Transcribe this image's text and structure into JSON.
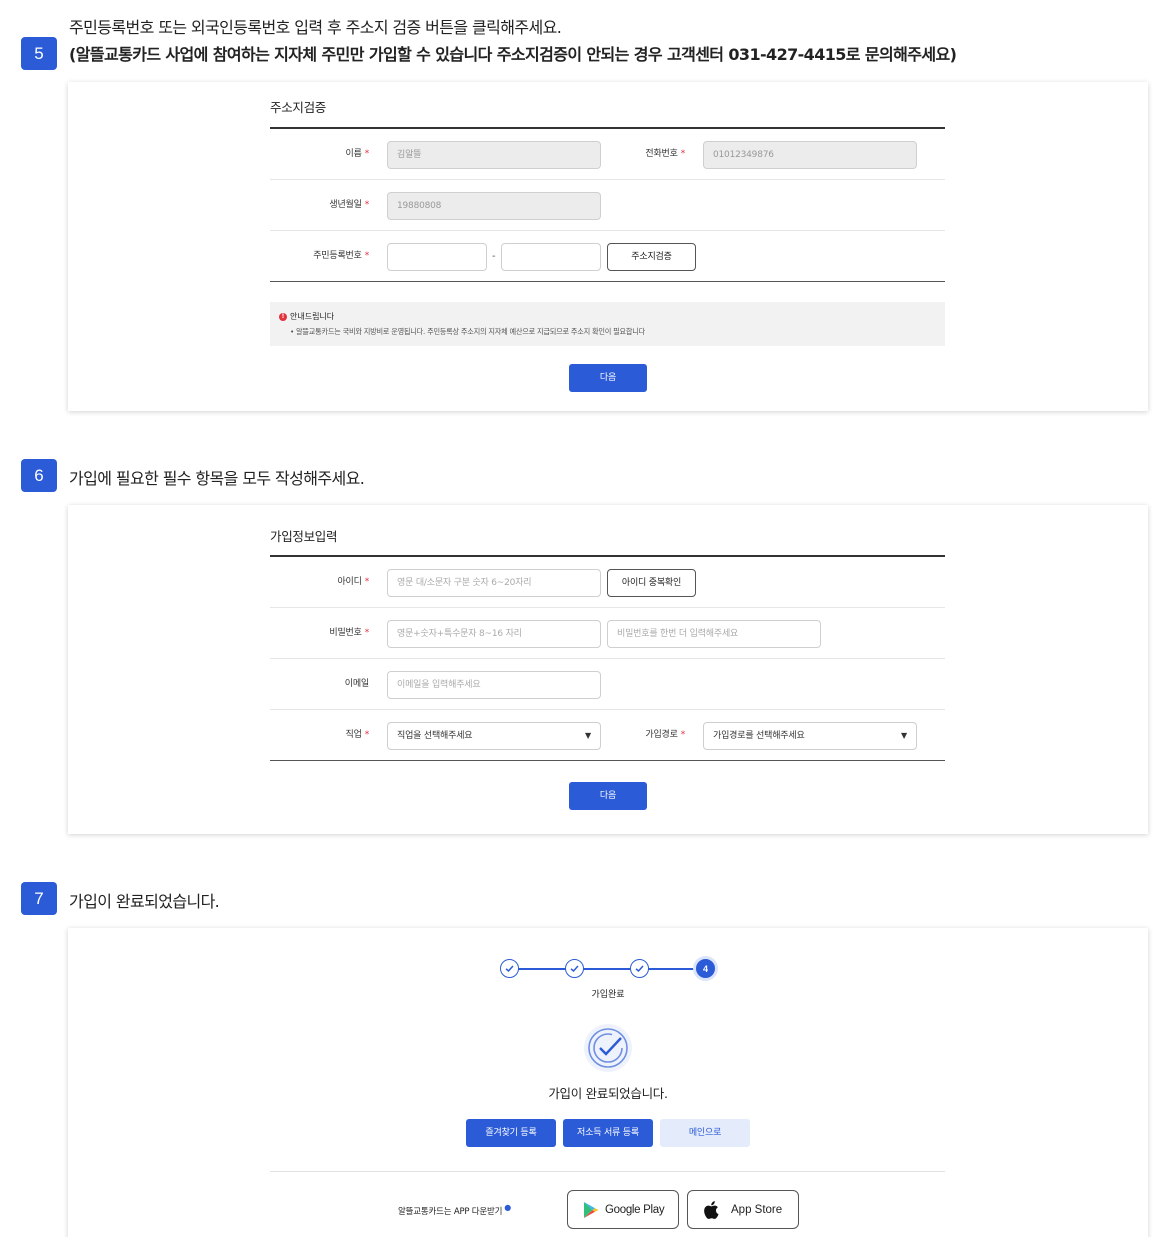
{
  "step5": {
    "number": "5",
    "line1": "주민등록번호 또는 외국인등록번호 입력 후 주소지 검증 버튼을 클릭해주세요.",
    "line2": "(알뜰교통카드 사업에 참여하는 지자체 주민만 가입할 수 있습니다 주소지검증이 안되는 경우 고객센터 031-427-4415로 문의해주세요)",
    "form": {
      "title": "주소지검증",
      "name_label": "이름",
      "name_value": "김알뜰",
      "phone_label": "전화번호",
      "phone_value": "01012349876",
      "birth_label": "생년월일",
      "birth_value": "19880808",
      "rrn_label": "주민등록번호",
      "rrn_dash": "-",
      "verify_button": "주소지검증"
    },
    "notice": {
      "title": "안내드립니다",
      "body": "• 알뜰교통카드는 국비와 지방비로 운영됩니다. 주민등록상 주소지의 지자체 예산으로 지급되므로 주소지 확인이 필요합니다"
    },
    "next_button": "다음"
  },
  "step6": {
    "number": "6",
    "text": "가입에 필요한 필수 항목을 모두 작성해주세요.",
    "form": {
      "title": "가입정보입력",
      "id_label": "아이디",
      "id_placeholder": "영문 대/소문자 구분 숫자 6~20자리",
      "id_check_button": "아이디 중복확인",
      "pw_label": "비밀번호",
      "pw_placeholder": "영문+숫자+특수문자 8~16 자리",
      "pw_confirm_placeholder": "비밀번호를 한번 더 입력해주세요",
      "email_label": "이메일",
      "email_placeholder": "이메일을 입력해주세요",
      "job_label": "직업",
      "job_select": "직업을 선택해주세요",
      "route_label": "가입경로",
      "route_select": "가입경로를 선택해주세요"
    },
    "next_button": "다음"
  },
  "step7": {
    "number": "7",
    "text": "가입이 완료되었습니다.",
    "stepper_active": "4",
    "stepper_label": "가입완료",
    "complete_message": "가입이 완료되었습니다.",
    "buttons": {
      "favorite": "즐겨찾기 등록",
      "low_income": "저소득 서류 등록",
      "main": "메인으로"
    },
    "app_download_label": "알뜰교통카드는 APP 다운받기",
    "google_play": "Google Play",
    "app_store": "App Store"
  },
  "colors": {
    "primary": "#2b5bd7",
    "required": "#e2323d",
    "light_button": "#e4ebfb"
  }
}
